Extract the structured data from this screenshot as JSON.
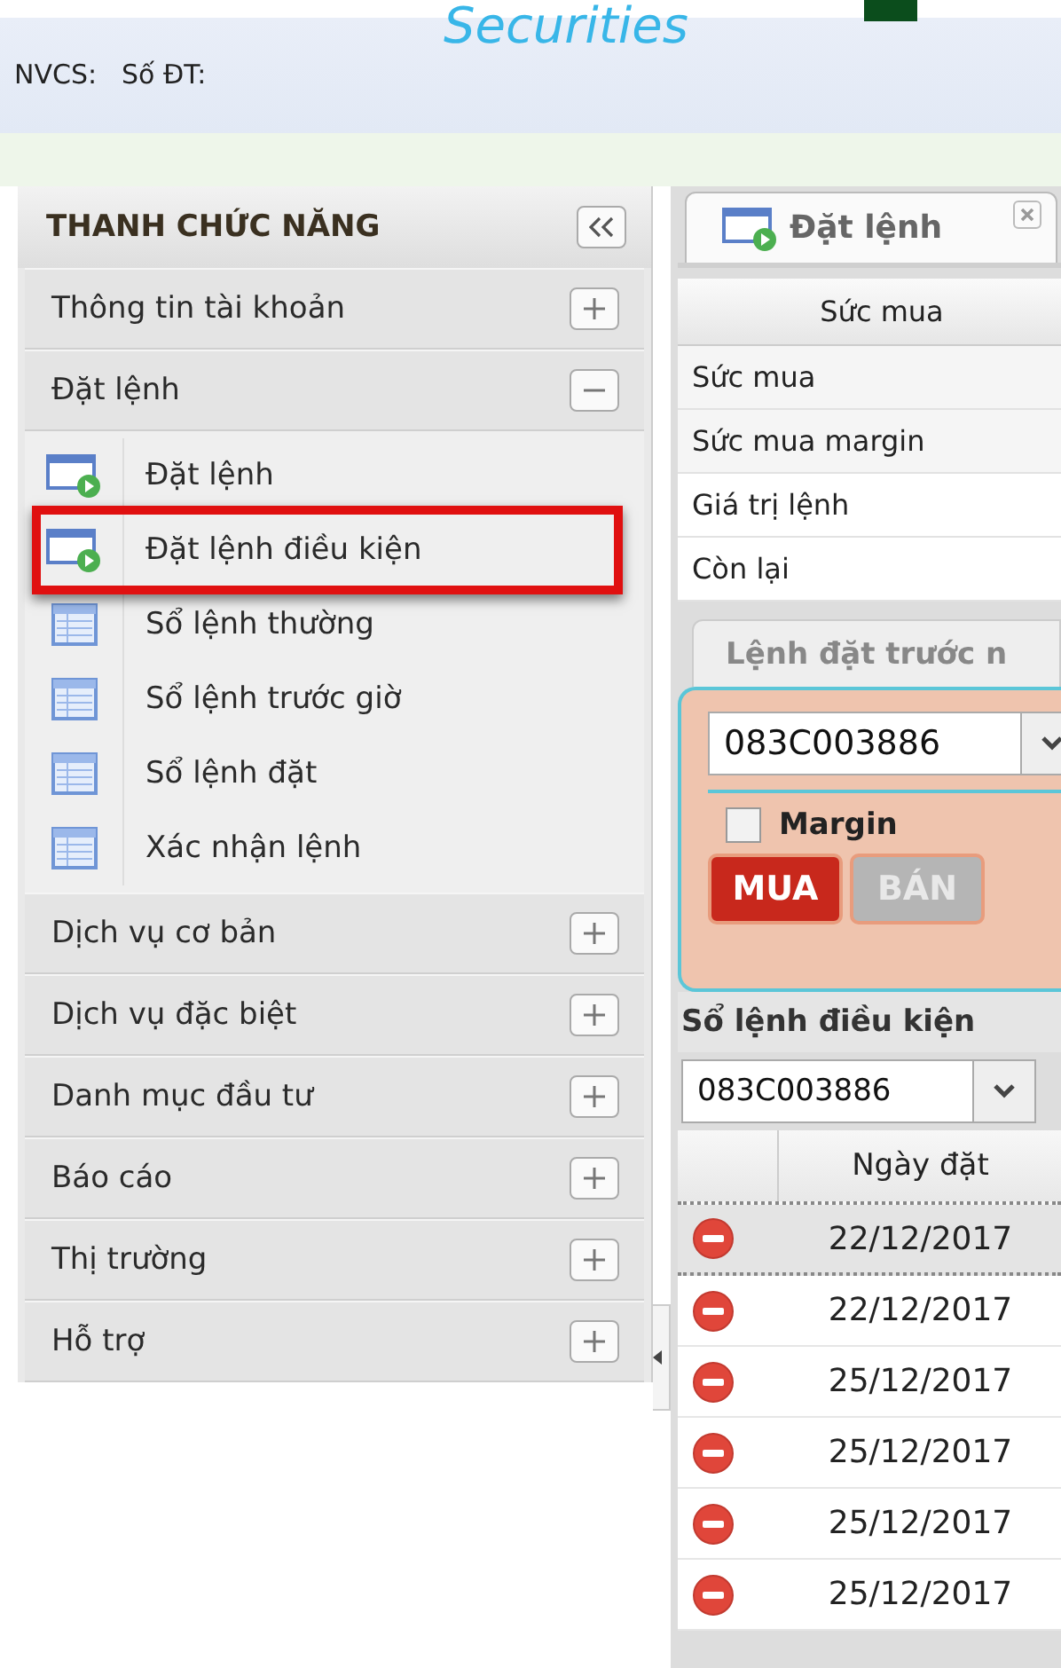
{
  "header": {
    "brand": "Securities",
    "staff_label": "NVCS:",
    "phone_label": "Số ĐT:"
  },
  "sidebar": {
    "title": "THANH CHỨC NĂNG",
    "sections": [
      {
        "label": "Thông tin tài khoản",
        "expanded": false
      },
      {
        "label": "Đặt lệnh",
        "expanded": true,
        "children": [
          {
            "label": "Đặt lệnh",
            "kind": "form",
            "highlighted": false
          },
          {
            "label": "Đặt lệnh điều kiện",
            "kind": "form",
            "highlighted": true
          },
          {
            "label": "Sổ lệnh thường",
            "kind": "list",
            "highlighted": false
          },
          {
            "label": "Sổ lệnh trước giờ",
            "kind": "list",
            "highlighted": false
          },
          {
            "label": "Sổ lệnh đặt",
            "kind": "list",
            "highlighted": false
          },
          {
            "label": "Xác nhận lệnh",
            "kind": "list",
            "highlighted": false
          }
        ]
      },
      {
        "label": "Dịch vụ cơ bản",
        "expanded": false
      },
      {
        "label": "Dịch vụ đặc biệt",
        "expanded": false
      },
      {
        "label": "Danh mục đầu tư",
        "expanded": false
      },
      {
        "label": "Báo cáo",
        "expanded": false
      },
      {
        "label": "Thị trường",
        "expanded": false
      },
      {
        "label": "Hỗ trợ",
        "expanded": false
      }
    ]
  },
  "main": {
    "tabs": [
      {
        "label": "Đặt lệnh",
        "selected": true
      }
    ],
    "buying_power": {
      "header": "Sức mua",
      "rows": [
        "Sức mua",
        "Sức mua margin",
        "Giá trị lệnh",
        "Còn lại"
      ]
    },
    "order_tab": "Lệnh đặt trước n",
    "order_form": {
      "account": "083C003886",
      "margin": {
        "label": "Margin",
        "checked": false
      },
      "sides": [
        {
          "label": "MUA",
          "selected": true
        },
        {
          "label": "BÁN",
          "selected": false
        }
      ]
    },
    "conditional_book": {
      "title": "Sổ lệnh điều kiện",
      "account": "083C003886",
      "columns": [
        "Ngày đặt"
      ],
      "rows": [
        {
          "date": "22/12/2017",
          "selected": true
        },
        {
          "date": "22/12/2017",
          "selected": false
        },
        {
          "date": "25/12/2017",
          "selected": false
        },
        {
          "date": "25/12/2017",
          "selected": false
        },
        {
          "date": "25/12/2017",
          "selected": false
        },
        {
          "date": "25/12/2017",
          "selected": false
        }
      ]
    }
  }
}
